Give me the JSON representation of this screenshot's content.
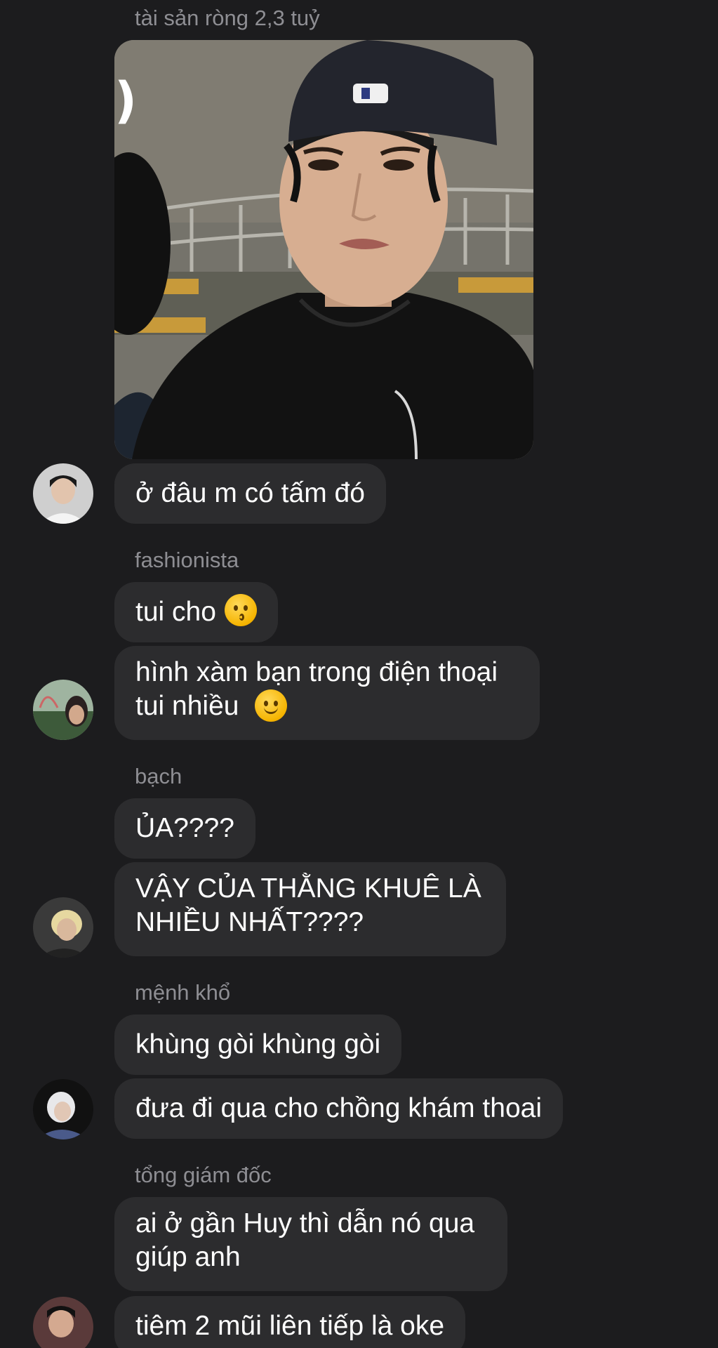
{
  "messages": [
    {
      "sender": "tài sản ròng 2,3 tuỷ",
      "photo_alt": "photo",
      "text": "ở đâu m có tấm đó"
    },
    {
      "sender": "fashionista",
      "text1": "tui cho",
      "emoji1": "kissing-face-emoji",
      "text2_line1": "hình xàm bạn trong điện thoại",
      "text2_line2": "tui nhiều",
      "emoji2": "slightly-smiling-face-emoji"
    },
    {
      "sender": "bạch",
      "text1": "ỦA????",
      "text2_line1": "VẬY CỦA THẰNG KHUÊ LÀ",
      "text2_line2": "NHIỀU NHẤT????"
    },
    {
      "sender": "mệnh khổ",
      "text1": "khùng gòi khùng gòi",
      "text2": "đưa đi qua cho chồng khám thoai"
    },
    {
      "sender": "tổng giám đốc",
      "text1_line1": "ai ở gần Huy thì dẫn nó qua",
      "text1_line2": "giúp anh",
      "text2": "tiêm 2 mũi liên tiếp là oke"
    }
  ],
  "colors": {
    "background": "#1c1c1e",
    "bubble": "#2c2c2e",
    "sender": "#8e8e93",
    "text": "#ffffff"
  }
}
